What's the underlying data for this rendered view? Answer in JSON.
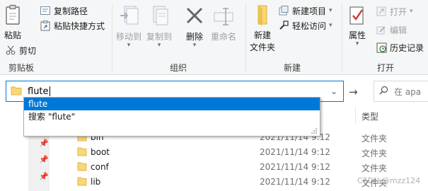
{
  "ribbon": {
    "clipboard": {
      "group_label": "剪贴板",
      "paste_label": "粘贴",
      "cut_label": "剪切",
      "copy_path_label": "复制路径",
      "paste_shortcut_label": "粘贴快捷方式"
    },
    "organize": {
      "group_label": "组织",
      "move_to_label": "移动到",
      "copy_to_label": "复制到",
      "delete_label": "删除",
      "rename_label": "重命名"
    },
    "new": {
      "group_label": "新建",
      "new_folder_line1": "新建",
      "new_folder_line2": "文件夹",
      "new_item_label": "新建项目",
      "easy_access_label": "轻松访问"
    },
    "open": {
      "group_label": "打开",
      "properties_label": "属性",
      "open_label": "打开",
      "edit_label": "编辑",
      "history_label": "历史记录"
    }
  },
  "address_bar": {
    "value": "flute",
    "search_placeholder": "在 apa"
  },
  "autocomplete": {
    "items": [
      "flute",
      "搜索 \"flute\""
    ]
  },
  "file_list": {
    "type_header": "类型",
    "rows": [
      {
        "name": "bin",
        "date": "2021/11/14 9:12",
        "type": "文件夹"
      },
      {
        "name": "boot",
        "date": "2021/11/14 9:12",
        "type": "文件夹"
      },
      {
        "name": "conf",
        "date": "2021/11/14 9:12",
        "type": "文件夹"
      },
      {
        "name": "lib",
        "date": "2021/11/14 9:12",
        "type": "文件夹"
      }
    ]
  },
  "watermark": "CSDN @mzz124",
  "colors": {
    "accent": "#0078d7",
    "folder": "#f8d775",
    "delete_red": "#d13438"
  }
}
